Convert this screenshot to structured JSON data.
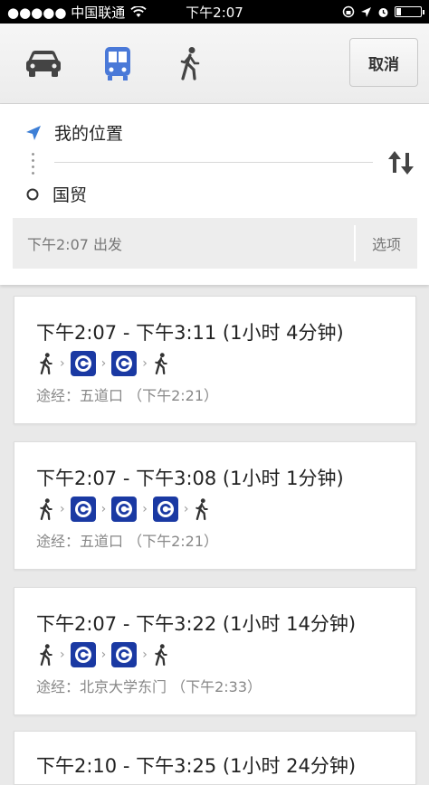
{
  "status_bar": {
    "carrier": "●●●●● 中国联通",
    "time": "下午2:07"
  },
  "modes": {
    "car_icon": "car-icon",
    "transit_icon": "bus-icon",
    "walk_icon": "walk-icon",
    "active_color": "#4a79d8"
  },
  "cancel_label": "取消",
  "route": {
    "from": "我的位置",
    "to": "国贸"
  },
  "depart": {
    "text": "下午2:07 出发",
    "options_label": "选项"
  },
  "results": [
    {
      "time": "下午2:07 - 下午3:11 (1小时 4分钟)",
      "steps": [
        "walk",
        "subway",
        "subway",
        "walk"
      ],
      "via": "途经：五道口 （下午2:21）"
    },
    {
      "time": "下午2:07 - 下午3:08 (1小时 1分钟)",
      "steps": [
        "walk",
        "subway",
        "subway",
        "subway",
        "walk"
      ],
      "via": "途经：五道口 （下午2:21）"
    },
    {
      "time": "下午2:07 - 下午3:22 (1小时 14分钟)",
      "steps": [
        "walk",
        "subway",
        "subway",
        "walk"
      ],
      "via": "途经：北京大学东门 （下午2:33）"
    }
  ],
  "partial_result": "下午2:10 - 下午3:25 (1小时 24分钟)"
}
